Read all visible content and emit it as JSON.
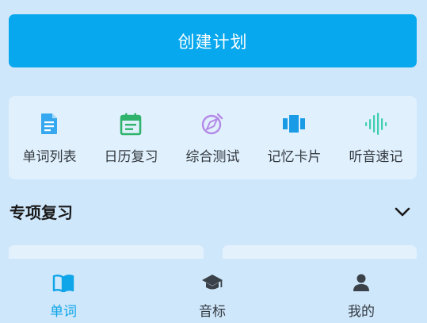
{
  "create_plan": {
    "label": "创建计划"
  },
  "tools": [
    {
      "label": "单词列表",
      "icon": "document-icon",
      "color": "#35a8f0"
    },
    {
      "label": "日历复习",
      "icon": "calendar-icon",
      "color": "#2fb36c"
    },
    {
      "label": "综合测试",
      "icon": "compass-icon",
      "color": "#b48ae8"
    },
    {
      "label": "记忆卡片",
      "icon": "cards-icon",
      "color": "#1a9be6"
    },
    {
      "label": "听音速记",
      "icon": "soundwave-icon",
      "color": "#3fcfae"
    }
  ],
  "special_review": {
    "title": "专项复习",
    "expand_icon": "chevron-down-icon"
  },
  "bottom_nav": [
    {
      "label": "单词",
      "icon": "book-icon",
      "active": true
    },
    {
      "label": "音标",
      "icon": "graduation-cap-icon",
      "active": false
    },
    {
      "label": "我的",
      "icon": "user-icon",
      "active": false
    }
  ],
  "colors": {
    "accent": "#08a8ee",
    "background": "#cfe7fb",
    "card": "#e1f0fd",
    "active_nav": "#0ea5e9",
    "inactive_nav_icon": "#3a4148"
  }
}
